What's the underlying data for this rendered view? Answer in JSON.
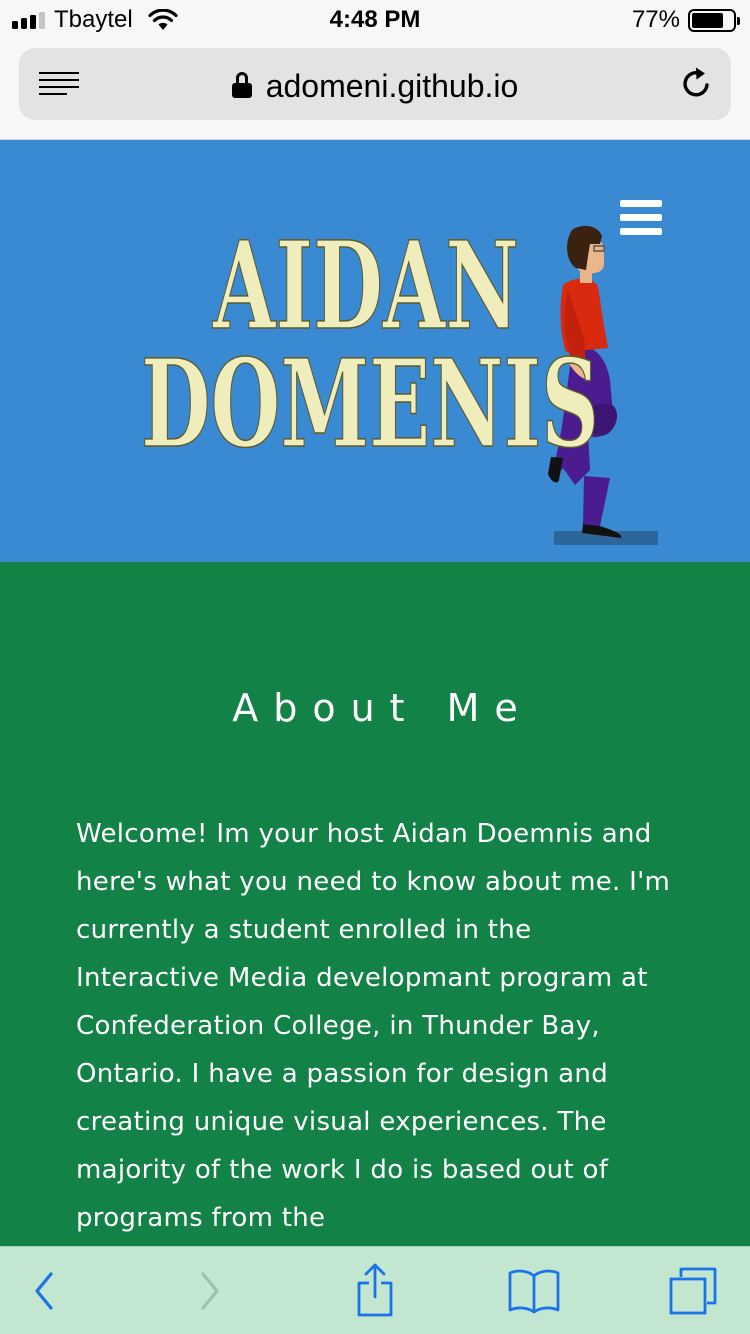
{
  "status_bar": {
    "carrier": "Tbaytel",
    "time": "4:48 PM",
    "battery_percent": "77%",
    "battery_level": 0.77,
    "signal_bars": 3
  },
  "browser": {
    "url": "adomeni.github.io",
    "icons": {
      "reader": "reader-mode-icon",
      "lock": "lock-icon",
      "reload": "reload-icon"
    }
  },
  "header": {
    "logo_line1": "AIDAN",
    "logo_line2": "DOMENIS",
    "menu_icon": "hamburger-icon",
    "colors": {
      "background": "#3a89d3",
      "logo": "#f0edbc"
    }
  },
  "about": {
    "title": "About Me",
    "body": "Welcome! Im your host Aidan Doemnis and here's what you need to know about me. I'm currently a student enrolled in the Interactive Media developmant program at Confederation College, in Thunder Bay, Ontario. I have a passion for design and creating unique visual experiences. The majority of the work I do is based out of programs from the",
    "colors": {
      "background": "#128246",
      "text": "#ffffff"
    }
  },
  "toolbar": {
    "icons": [
      "back-icon",
      "forward-icon",
      "share-icon",
      "bookmarks-icon",
      "tabs-icon"
    ],
    "colors": {
      "background": "#c3e6d1",
      "icon": "#1a73e8"
    }
  }
}
